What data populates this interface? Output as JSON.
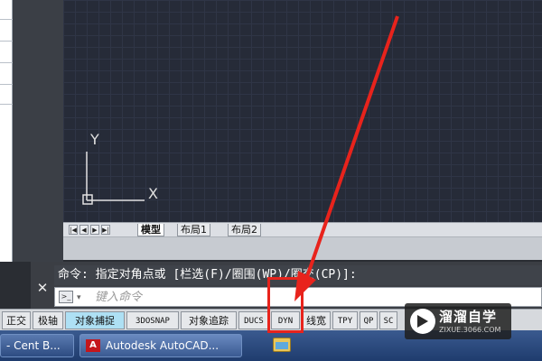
{
  "drawing": {
    "ucs_y_label": "Y",
    "ucs_x_label": "X"
  },
  "layout_tabs": {
    "nav": [
      "|◀",
      "◀",
      "▶",
      "▶|"
    ],
    "tabs": [
      "模型",
      "布局1",
      "布局2"
    ],
    "active": "模型"
  },
  "command": {
    "close_glyph": "✕",
    "history": "命令: 指定对角点或 [栏选(F)/圈围(WP)/圈交(CP)]:",
    "prompt_icon": ">_",
    "placeholder": "键入命令"
  },
  "status_bar": {
    "buttons": [
      {
        "label": "正交",
        "on": false
      },
      {
        "label": "极轴",
        "on": false
      },
      {
        "label": "对象捕捉",
        "on": true
      },
      {
        "label": "3DOSNAP",
        "on": false
      },
      {
        "label": "对象追踪",
        "on": false
      },
      {
        "label": "DUCS",
        "on": false
      },
      {
        "label": "DYN",
        "on": false
      },
      {
        "label": "线宽",
        "on": false
      },
      {
        "label": "TPY",
        "on": false
      },
      {
        "label": "QP",
        "on": false
      },
      {
        "label": "SC",
        "on": false
      }
    ]
  },
  "taskbar": {
    "items": [
      "- Cent B...",
      "Autodesk AutoCAD..."
    ],
    "acad_logo": "A"
  },
  "watermark": {
    "title": "溜溜自学",
    "url": "ZIXUE.3066.COM"
  },
  "colors": {
    "canvas_bg": "#262b38",
    "annotation_red": "#e8231c",
    "snap_on_bg": "#aee0f4"
  }
}
